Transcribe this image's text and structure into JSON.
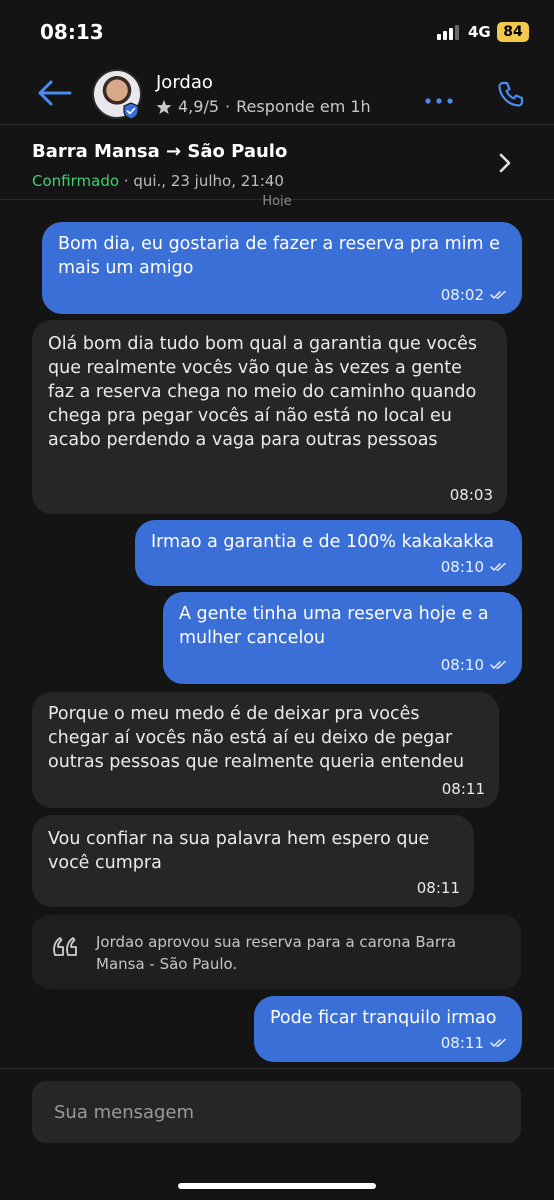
{
  "status_bar": {
    "time": "08:13",
    "network": "4G",
    "battery": "84"
  },
  "header": {
    "contact_name": "Jordao",
    "rating": "4,9/5",
    "separator": "·",
    "response_time": "Responde em 1h"
  },
  "trip": {
    "route": "Barra Mansa → São Paulo",
    "status": "Confirmado",
    "datetime": " · qui., 23 julho, 21:40"
  },
  "day_separator": "Hoje",
  "messages": [
    {
      "direction": "out",
      "text": "Bom dia, eu gostaria de fazer a reserva pra mim e mais um amigo",
      "time": "08:02"
    },
    {
      "direction": "in",
      "text": "Olá bom dia tudo bom qual a garantia que vocês que realmente vocês vão que às vezes a gente faz a reserva chega no meio do caminho quando chega pra pegar vocês aí não está no local eu acabo perdendo a vaga para outras pessoas",
      "time": "08:03"
    },
    {
      "direction": "out",
      "text": "Irmao a garantia e de 100% kakakakka",
      "time": "08:10"
    },
    {
      "direction": "out",
      "text": "A gente tinha uma reserva hoje e a mulher cancelou",
      "time": "08:10"
    },
    {
      "direction": "in",
      "text": "Porque o meu medo é de deixar pra vocês chegar aí vocês não está aí eu deixo de pegar outras pessoas que realmente queria entendeu",
      "time": "08:11"
    },
    {
      "direction": "in",
      "text": "Vou confiar na sua palavra hem espero que você cumpra",
      "time": "08:11"
    },
    {
      "direction": "out",
      "text": "Pode ficar tranquilo irmao",
      "time": "08:11"
    }
  ],
  "system_message": "Jordao aprovou sua reserva para a carona Barra Mansa - São Paulo.",
  "composer": {
    "placeholder": "Sua mensagem"
  },
  "colors": {
    "accent": "#3a6fd8",
    "icon_blue": "#4a8cf0",
    "confirmed_green": "#3fcf72",
    "battery_yellow": "#f2c94c",
    "background": "#141414",
    "incoming_bubble": "#262626"
  },
  "icons": [
    "back-arrow-icon",
    "verified-shield-icon",
    "star-icon",
    "more-dots-icon",
    "phone-icon",
    "chevron-right-icon",
    "double-check-icon",
    "quote-icon"
  ]
}
